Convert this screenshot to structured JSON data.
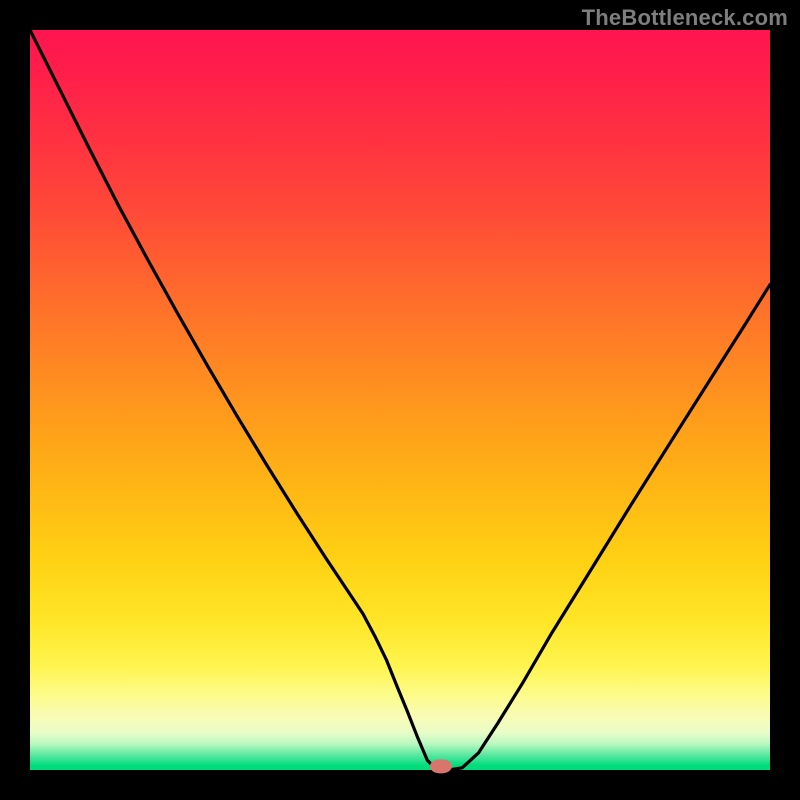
{
  "watermark": "TheBottleneck.com",
  "colors": {
    "background": "#000000",
    "marker": "#d8766c",
    "curve": "#000000"
  },
  "chart_data": {
    "type": "line",
    "title": "",
    "xlabel": "",
    "ylabel": "",
    "xlim": [
      0,
      100
    ],
    "ylim": [
      0,
      100
    ],
    "grid": false,
    "curve_x": [
      0,
      4,
      8,
      12,
      16,
      20,
      24,
      28,
      32,
      36,
      40,
      43,
      45,
      46.7,
      48.2,
      49.6,
      51.0,
      52.3,
      53.7,
      55.0,
      56.6,
      58.4,
      60.6,
      63.2,
      66.6,
      70.5,
      75.4,
      81.2,
      88.2,
      96.5,
      100
    ],
    "curve_y": [
      100,
      92,
      84,
      76.2,
      68.8,
      61.6,
      54.6,
      47.8,
      41.2,
      34.8,
      28.6,
      24.1,
      21.1,
      17.9,
      14.8,
      11.3,
      7.9,
      4.6,
      1.3,
      0.0,
      0.0,
      0.3,
      2.3,
      6.3,
      11.8,
      18.5,
      26.4,
      35.8,
      46.9,
      60.0,
      65.6
    ],
    "minimum_marker": {
      "x": 55.5,
      "y": 0.5,
      "w": 3.0,
      "h": 1.8
    },
    "gradient_stops": [
      {
        "pos": 0.0,
        "color": "#ff1450"
      },
      {
        "pos": 0.5,
        "color": "#ff9a1c"
      },
      {
        "pos": 0.86,
        "color": "#fff450"
      },
      {
        "pos": 0.95,
        "color": "#e8fcc8"
      },
      {
        "pos": 1.0,
        "color": "#00dc7c"
      }
    ]
  }
}
